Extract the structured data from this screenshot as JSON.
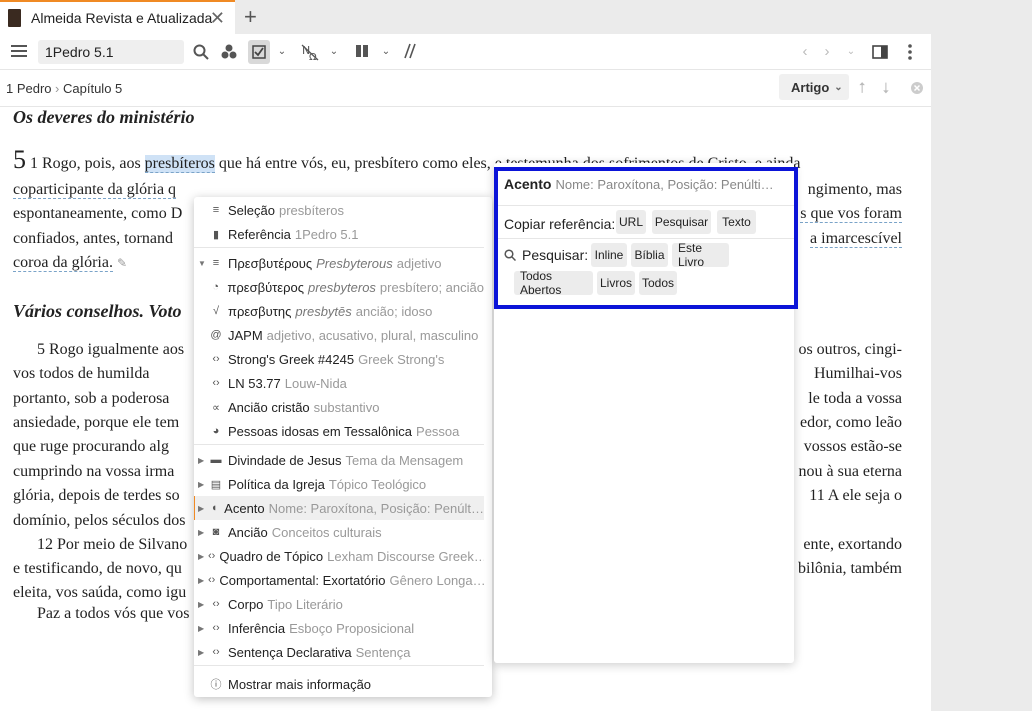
{
  "tab": {
    "title": "Almeida Revista e Atualizada",
    "close": "✕",
    "new": "+"
  },
  "toolbar": {
    "reference": "1Pedro 5.1"
  },
  "breadcrumb": {
    "book": "1 Pedro",
    "chapter": "Capítulo 5",
    "section_button": "Artigo"
  },
  "text": {
    "heading1": "Os deveres do ministério",
    "chapter_number": "5",
    "lines": [
      "1 Rogo, pois, aos presbíteros que há entre vós, eu, presbítero como eles, e testemunha dos sofrimentos de Cristo, e ainda",
      "coparticipante da glória q",
      "espontaneamente, como D",
      "confiados, antes, tornand",
      "coroa da glória."
    ],
    "right_lines": [
      "ngimento, mas",
      "s que vos foram",
      "a imarcescível"
    ],
    "heading2": "Vários conselhos. Voto",
    "p2_left": [
      "5 Rogo igualmente aos",
      "vos  todos de humilda",
      "portanto, sob a poderosa",
      "ansiedade, porque ele tem",
      "que ruge procurando alg",
      "cumprindo na vossa irma",
      "glória, depois de terdes so",
      "domínio, pelos séculos dos",
      "12 Por meio de Silvano",
      "e testificando, de novo, qu",
      "eleita, vos saúda, como igu",
      "Paz a todos vós que vos"
    ],
    "p2_right": [
      "os outros, cingi-",
      "Humilhai-vos",
      "le toda a vossa",
      "edor, como leão",
      "vossos estão-se",
      "nou à sua eterna",
      "11 A ele seja o",
      "",
      "ente, exortando",
      "bilônia, também",
      "",
      ""
    ]
  },
  "menu": {
    "items": [
      {
        "label": "Seleção",
        "sub": "presbíteros",
        "icon": "list-icon"
      },
      {
        "label": "Referência",
        "sub": "1Pedro 5.1",
        "icon": "bookmark-icon"
      },
      {
        "label": "Πρεσβυτέρους",
        "subit": "Presbyterous",
        "sub": "adjetivo",
        "icon": "list-icon"
      },
      {
        "label": "πρεσβύτερος",
        "subit": "presbyteros",
        "sub": "presbítero; ancião",
        "icon": "lemma-icon"
      },
      {
        "label": "πρεσβυτης",
        "subit": "presbytēs",
        "sub": "ancião; idoso",
        "icon": "root-icon"
      },
      {
        "label": "JAPM",
        "sub": "adjetivo, acusativo, plural, masculino",
        "icon": "at-icon"
      },
      {
        "label": "Strong's Greek #4245",
        "sub": "Greek Strong's",
        "icon": "code-icon"
      },
      {
        "label": "LN 53.77",
        "sub": "Louw-Nida",
        "icon": "code-icon"
      },
      {
        "label": "Ancião cristão",
        "sub": "substantivo",
        "icon": "sense-icon"
      },
      {
        "label": "Pessoas idosas em Tessalônica",
        "sub": "Pessoa",
        "icon": "person-icon"
      },
      {
        "label": "Divindade de Jesus",
        "sub": "Tema da Mensagem",
        "icon": "trash-icon"
      },
      {
        "label": "Política da Igreja",
        "sub": "Tópico Teológico",
        "icon": "book-icon"
      },
      {
        "label": "Acento",
        "sub": "Nome: Paroxítona, Posição: Penúlt…",
        "icon": "tag-icon"
      },
      {
        "label": "Ancião",
        "sub": "Conceitos culturais",
        "icon": "jar-icon"
      },
      {
        "label": "Quadro de Tópico",
        "sub": "Lexham Discourse Greek…",
        "icon": "code-icon"
      },
      {
        "label": "Comportamental: Exortatório",
        "sub": "Gênero Longa…",
        "icon": "code-icon"
      },
      {
        "label": "Corpo",
        "sub": "Tipo Literário",
        "icon": "code-icon"
      },
      {
        "label": "Inferência",
        "sub": "Esboço Proposicional",
        "icon": "code-icon"
      },
      {
        "label": "Sentença Declarativa",
        "sub": "Sentença",
        "icon": "code-icon"
      }
    ],
    "more": "Mostrar mais informação"
  },
  "detail": {
    "title": "Acento",
    "title_sub": "Nome: Paroxítona, Posição: Penúlti…",
    "copy_label": "Copiar referência:",
    "copy_buttons": [
      "URL",
      "Pesquisar",
      "Texto"
    ],
    "search_label": "Pesquisar:",
    "search_buttons": [
      "Inline",
      "Bíblia",
      "Este Livro",
      "Todos Abertos",
      "Livros",
      "Todos"
    ]
  }
}
